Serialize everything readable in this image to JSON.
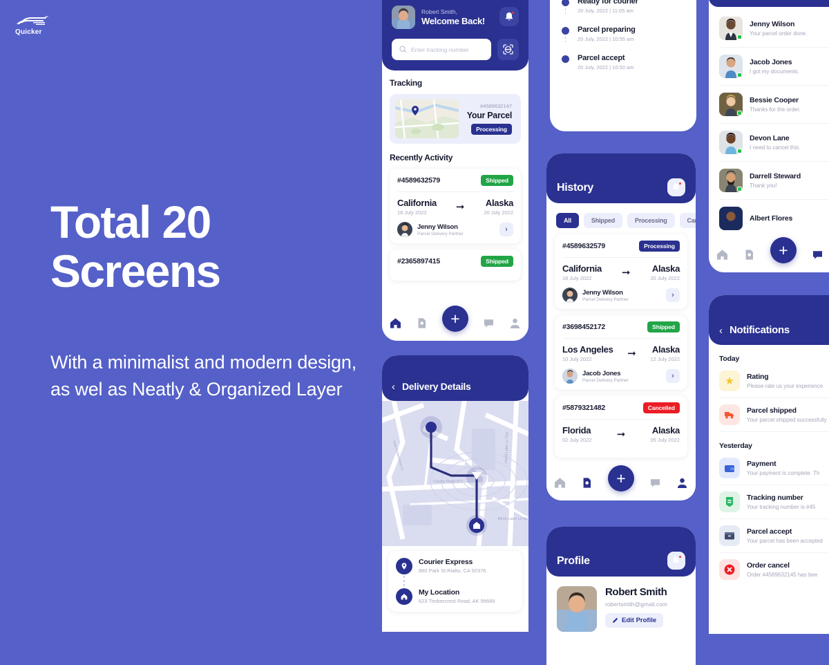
{
  "brand": {
    "name": "Quicker",
    "logo_icon": "fast-truck-logo"
  },
  "promo": {
    "headline_line1": "Total 20",
    "headline_line2": "Screens",
    "subtext": "With a minimalist and modern design, as wel as Neatly & Organized Layer"
  },
  "colors": {
    "background": "#5560c8",
    "header_navy": "#2a3190",
    "accent": "#3b43a3",
    "chip_bg": "#eceefb",
    "shipped": "#22a546",
    "processing": "#2a3190",
    "cancelled": "#ec1c24",
    "muted_text": "#a4a7bb"
  },
  "home": {
    "user_greeting": "Robert Smith,",
    "welcome": "Welcome Back!",
    "notification_icon": "bell-icon",
    "search_placeholder": "Enter tracking number",
    "search_value": "",
    "search_icon": "search-icon",
    "scan_icon": "scan-barcode-icon",
    "tracking_title": "Tracking",
    "parcel": {
      "id": "#4589632147",
      "name": "Your Parcel",
      "status": "Processing"
    },
    "activity_title": "Recently Activity",
    "activities": [
      {
        "id": "#4589632579",
        "status": "Shipped",
        "from": "California",
        "from_date": "18 July 2022",
        "to": "Alaska",
        "to_date": "20 July 2022",
        "partner": "Jenny Wilson",
        "partner_role": "Parcel Delivery Partner"
      },
      {
        "id": "#2365897415",
        "status": "Shipped"
      }
    ],
    "nav": [
      "home-icon",
      "document-icon",
      "add-icon",
      "chat-icon",
      "profile-icon"
    ]
  },
  "delivery": {
    "title": "Delivery Details",
    "back_icon": "chevron-left-icon",
    "map_label_1": "County Road 971",
    "map_label_2": "Birch Lawn Ln No",
    "map_label_3": "Hood Lake Ln The",
    "stops": [
      {
        "icon": "location-pin-icon",
        "title": "Courier Express",
        "address": "860 Park St.Rialto, CA 92376"
      },
      {
        "icon": "home-icon",
        "title": "My Location",
        "address": "623 Timbercrest Road, AK 99669"
      }
    ]
  },
  "timeline": {
    "events": [
      {
        "title": "Ready for courier",
        "time": "20 July, 2022  |  11:05 am"
      },
      {
        "title": "Parcel preparing",
        "time": "20 July, 2022  |  10:55 am"
      },
      {
        "title": "Parcel accept",
        "time": "20 July, 2022  |  10:50 am"
      }
    ]
  },
  "history": {
    "title": "History",
    "notification_icon": "bell-icon",
    "filters": [
      {
        "label": "All",
        "active": true
      },
      {
        "label": "Shipped",
        "active": false
      },
      {
        "label": "Processing",
        "active": false
      },
      {
        "label": "Cancelled",
        "active": false
      }
    ],
    "items": [
      {
        "id": "#4589632579",
        "status": "Processing",
        "from": "California",
        "from_date": "18 July 2022",
        "to": "Alaska",
        "to_date": "20 July 2022",
        "partner": "Jenny Wilson",
        "partner_role": "Parcel Delivery Partner"
      },
      {
        "id": "#3698452172",
        "status": "Shipped",
        "from": "Los Angeles",
        "from_date": "10 July 2022",
        "to": "Alaska",
        "to_date": "12 July 2022",
        "partner": "Jacob Jones",
        "partner_role": "Parcel Delivery Partner"
      },
      {
        "id": "#5879321482",
        "status": "Cancelled",
        "from": "Florida",
        "from_date": "02 July 2022",
        "to": "Alaska",
        "to_date": "05 July 2022"
      }
    ],
    "nav": [
      "home-icon",
      "document-icon",
      "add-icon",
      "chat-icon",
      "profile-icon"
    ]
  },
  "profile": {
    "title": "Profile",
    "notification_icon": "bell-icon",
    "name": "Robert Smith",
    "email": "robertsmith@gmail.com",
    "edit_label": "Edit Profile",
    "edit_icon": "pencil-icon"
  },
  "chat": {
    "conversations": [
      {
        "name": "Jenny Wilson",
        "message": "Your parcel order done."
      },
      {
        "name": "Jacob Jones",
        "message": "I got my documents."
      },
      {
        "name": "Bessie Cooper",
        "message": "Thanks for the order."
      },
      {
        "name": "Devon Lane",
        "message": "I need to cancel this."
      },
      {
        "name": "Darrell Steward",
        "message": "Thank you!"
      },
      {
        "name": "Albert Flores",
        "message": ""
      }
    ],
    "nav": [
      "home-icon",
      "document-icon",
      "add-icon",
      "chat-icon",
      "profile-icon"
    ]
  },
  "notifications": {
    "title": "Notifications",
    "back_icon": "chevron-left-icon",
    "groups": [
      {
        "label": "Today",
        "items": [
          {
            "icon": "star-icon",
            "title": "Rating",
            "text": "Please rate us your experience",
            "bg": "#fdf4d6",
            "color": "#f7c325"
          },
          {
            "icon": "truck-icon",
            "title": "Parcel shipped",
            "text": "Your parcel shipped successfully",
            "bg": "#fde6e2",
            "color": "#f4572e"
          }
        ]
      },
      {
        "label": "Yesterday",
        "items": [
          {
            "icon": "wallet-icon",
            "title": "Payment",
            "text": "Your payment is complete. Th",
            "bg": "#e3e9fd",
            "color": "#3b62d6"
          },
          {
            "icon": "tag-icon",
            "title": "Tracking number",
            "text": "Your tracking number is #45",
            "bg": "#dff3e6",
            "color": "#29b765"
          },
          {
            "icon": "box-icon",
            "title": "Parcel accept",
            "text": "Your parcel has been accepted",
            "bg": "#e6eaf4",
            "color": "#3d4a6b"
          },
          {
            "icon": "cancel-icon",
            "title": "Order cancel",
            "text": "Order #4589632145 has bee",
            "bg": "#fde2e2",
            "color": "#ec1c24"
          }
        ]
      }
    ]
  }
}
